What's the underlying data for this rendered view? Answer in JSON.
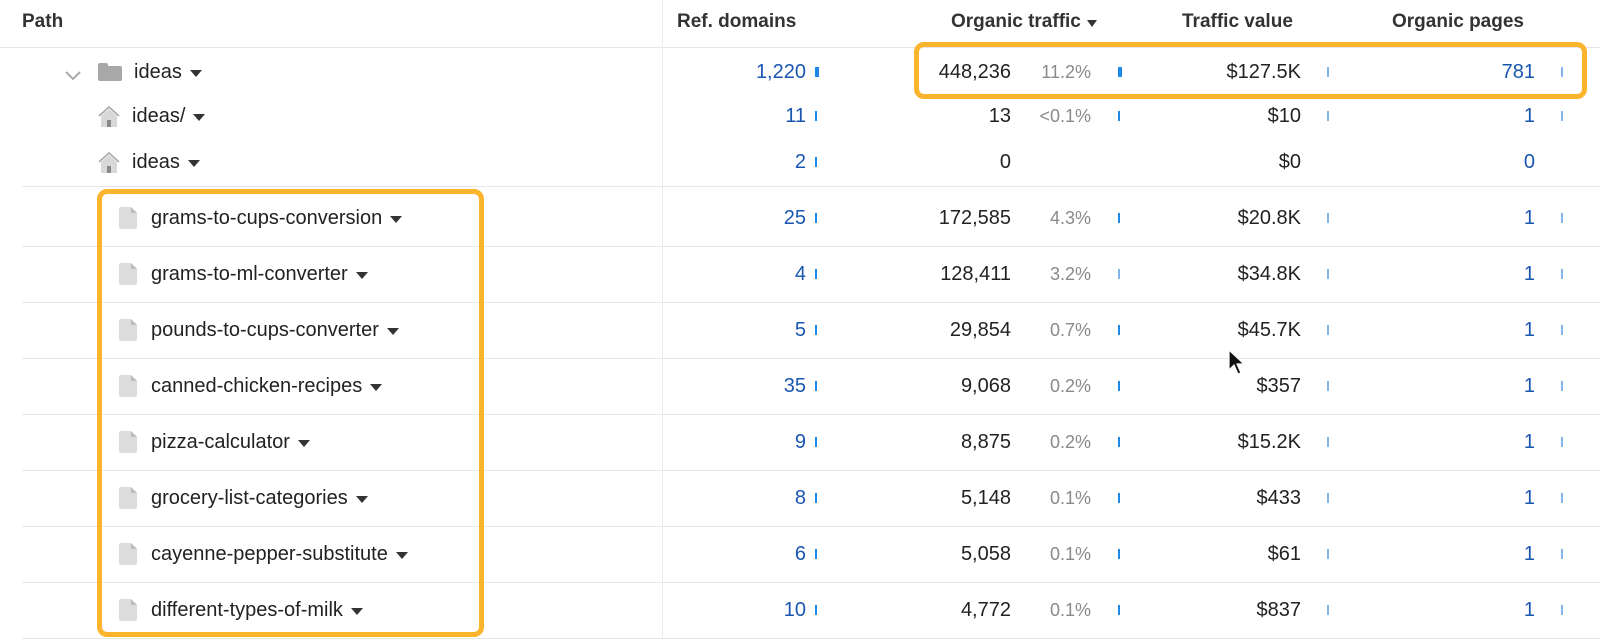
{
  "columns": {
    "path": "Path",
    "ref_domains": "Ref. domains",
    "organic_traffic": "Organic traffic",
    "traffic_value": "Traffic value",
    "organic_pages": "Organic pages"
  },
  "sort": {
    "column": "organic_traffic",
    "direction": "desc",
    "icon": "caret-down-icon"
  },
  "rows": [
    {
      "type": "folder",
      "icon": "folder-icon",
      "expanded": true,
      "path": "ideas",
      "ref_domains": "1,220",
      "traffic": "448,236",
      "traffic_pct": "11.2%",
      "traffic_value": "$127.5K",
      "organic_pages": "781"
    },
    {
      "type": "home",
      "icon": "home-icon",
      "path": "ideas/",
      "ref_domains": "11",
      "traffic": "13",
      "traffic_pct": "<0.1%",
      "traffic_value": "$10",
      "organic_pages": "1"
    },
    {
      "type": "home",
      "icon": "home-icon",
      "path": "ideas",
      "ref_domains": "2",
      "traffic": "0",
      "traffic_pct": "",
      "traffic_value": "$0",
      "organic_pages": "0"
    },
    {
      "type": "file",
      "icon": "file-icon",
      "path": "grams-to-cups-conversion",
      "ref_domains": "25",
      "traffic": "172,585",
      "traffic_pct": "4.3%",
      "traffic_value": "$20.8K",
      "organic_pages": "1"
    },
    {
      "type": "file",
      "icon": "file-icon",
      "path": "grams-to-ml-converter",
      "ref_domains": "4",
      "traffic": "128,411",
      "traffic_pct": "3.2%",
      "traffic_value": "$34.8K",
      "organic_pages": "1"
    },
    {
      "type": "file",
      "icon": "file-icon",
      "path": "pounds-to-cups-converter",
      "ref_domains": "5",
      "traffic": "29,854",
      "traffic_pct": "0.7%",
      "traffic_value": "$45.7K",
      "organic_pages": "1"
    },
    {
      "type": "file",
      "icon": "file-icon",
      "path": "canned-chicken-recipes",
      "ref_domains": "35",
      "traffic": "9,068",
      "traffic_pct": "0.2%",
      "traffic_value": "$357",
      "organic_pages": "1"
    },
    {
      "type": "file",
      "icon": "file-icon",
      "path": "pizza-calculator",
      "ref_domains": "9",
      "traffic": "8,875",
      "traffic_pct": "0.2%",
      "traffic_value": "$15.2K",
      "organic_pages": "1"
    },
    {
      "type": "file",
      "icon": "file-icon",
      "path": "grocery-list-categories",
      "ref_domains": "8",
      "traffic": "5,148",
      "traffic_pct": "0.1%",
      "traffic_value": "$433",
      "organic_pages": "1"
    },
    {
      "type": "file",
      "icon": "file-icon",
      "path": "cayenne-pepper-substitute",
      "ref_domains": "6",
      "traffic": "5,058",
      "traffic_pct": "0.1%",
      "traffic_value": "$61",
      "organic_pages": "1"
    },
    {
      "type": "file",
      "icon": "file-icon",
      "path": "different-types-of-milk",
      "ref_domains": "10",
      "traffic": "4,772",
      "traffic_pct": "0.1%",
      "traffic_value": "$837",
      "organic_pages": "1"
    }
  ],
  "colors": {
    "highlight": "#fbb42c",
    "link": "#1a56b0",
    "bar": "#1e88e5",
    "muted": "#8a8a8a"
  }
}
